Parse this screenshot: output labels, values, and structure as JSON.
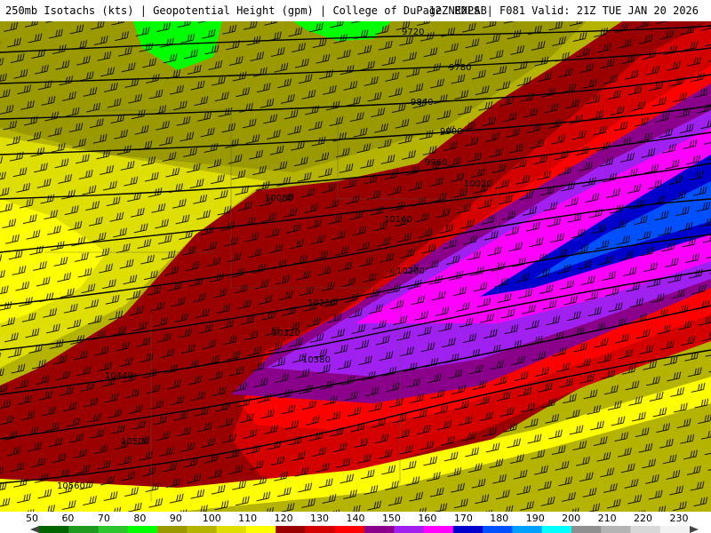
{
  "header": {
    "left": "250mb Isotachs (kts) | Geopotential Height (gpm) | College of DuPage NEXLAB",
    "right": "12Z RDPS | F081 Valid: 21Z TUE JAN 20 2026"
  },
  "contour_labels": [
    "9720",
    "9780",
    "9840",
    "9900",
    "9960",
    "10020",
    "10080",
    "10140",
    "10200",
    "10260",
    "10320",
    "10380",
    "10440",
    "10500",
    "10560"
  ],
  "legend": {
    "ticks": [
      "50",
      "60",
      "70",
      "80",
      "90",
      "100",
      "110",
      "120",
      "130",
      "140",
      "150",
      "160",
      "170",
      "180",
      "190",
      "200",
      "210",
      "220",
      "230"
    ],
    "colors": [
      "#006400",
      "#1e9b1e",
      "#2dc52d",
      "#00ff00",
      "#9a9a00",
      "#b4b400",
      "#dede00",
      "#ffff00",
      "#9b0000",
      "#d40000",
      "#ff0000",
      "#8b008b",
      "#a020f0",
      "#ff00ff",
      "#0000cd",
      "#0050ff",
      "#00a0ff",
      "#00ffff",
      "#8f8f8f",
      "#b4b4b4",
      "#d8d8d8",
      "#f2f2f2"
    ]
  }
}
